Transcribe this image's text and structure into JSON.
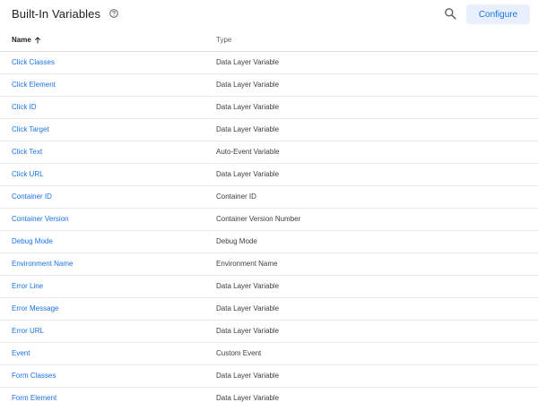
{
  "header": {
    "title": "Built-In Variables",
    "help_icon": "help-circle-icon",
    "search_icon": "search-icon",
    "configure_label": "Configure"
  },
  "table": {
    "columns": {
      "name": "Name",
      "name_sort": "arrow-up-icon",
      "type": "Type"
    },
    "rows": [
      {
        "name": "Click Classes",
        "type": "Data Layer Variable"
      },
      {
        "name": "Click Element",
        "type": "Data Layer Variable"
      },
      {
        "name": "Click ID",
        "type": "Data Layer Variable"
      },
      {
        "name": "Click Target",
        "type": "Data Layer Variable"
      },
      {
        "name": "Click Text",
        "type": "Auto-Event Variable"
      },
      {
        "name": "Click URL",
        "type": "Data Layer Variable"
      },
      {
        "name": "Container ID",
        "type": "Container ID"
      },
      {
        "name": "Container Version",
        "type": "Container Version Number"
      },
      {
        "name": "Debug Mode",
        "type": "Debug Mode"
      },
      {
        "name": "Environment Name",
        "type": "Environment Name"
      },
      {
        "name": "Error Line",
        "type": "Data Layer Variable"
      },
      {
        "name": "Error Message",
        "type": "Data Layer Variable"
      },
      {
        "name": "Error URL",
        "type": "Data Layer Variable"
      },
      {
        "name": "Event",
        "type": "Custom Event"
      },
      {
        "name": "Form Classes",
        "type": "Data Layer Variable"
      },
      {
        "name": "Form Element",
        "type": "Data Layer Variable"
      }
    ]
  },
  "colors": {
    "link": "#1a73e8",
    "button_bg": "#e8f0fe",
    "divider": "#e8eaed"
  }
}
